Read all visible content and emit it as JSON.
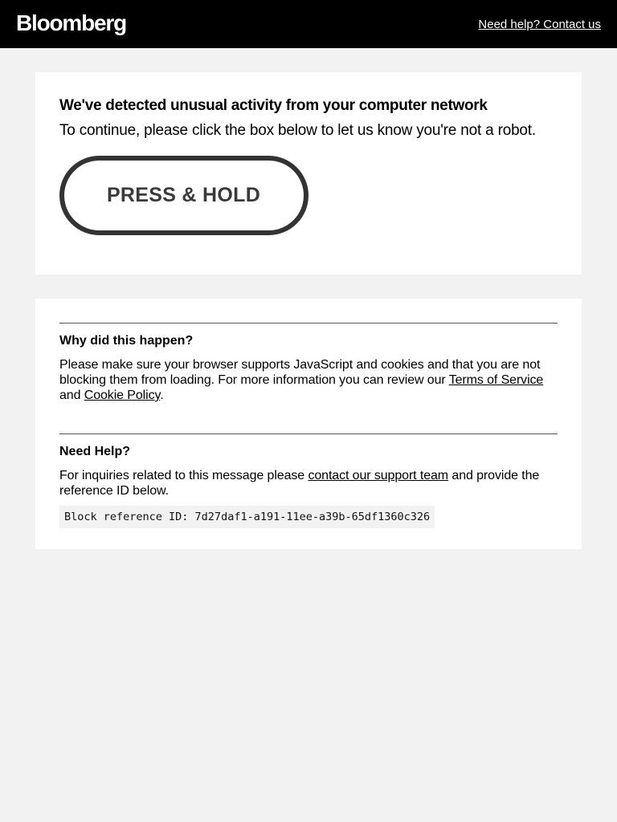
{
  "header": {
    "logo_text": "Bloomberg",
    "help_link": "Need help? Contact us"
  },
  "challenge": {
    "headline": "We've detected unusual activity from your computer network",
    "subline": "To continue, please click the box below to let us know you're not a robot.",
    "button_label": "PRESS & HOLD"
  },
  "info": {
    "why": {
      "title": "Why did this happen?",
      "text_before": "Please make sure your browser supports JavaScript and cookies and that you are not blocking them from loading. For more information you can review our ",
      "terms_link": "Terms of Service",
      "text_middle": " and ",
      "cookie_link": "Cookie Policy",
      "text_after": "."
    },
    "help": {
      "title": "Need Help?",
      "text_before": "For inquiries related to this message please ",
      "support_link": "contact our support team",
      "text_after": " and provide the reference ID below.",
      "reference": "Block reference ID: 7d27daf1-a191-11ee-a39b-65df1360c326"
    }
  },
  "colors": {
    "header_bg": "#000000",
    "page_bg": "#f2f2f2",
    "card_bg": "#ffffff",
    "button_border": "#333333"
  }
}
